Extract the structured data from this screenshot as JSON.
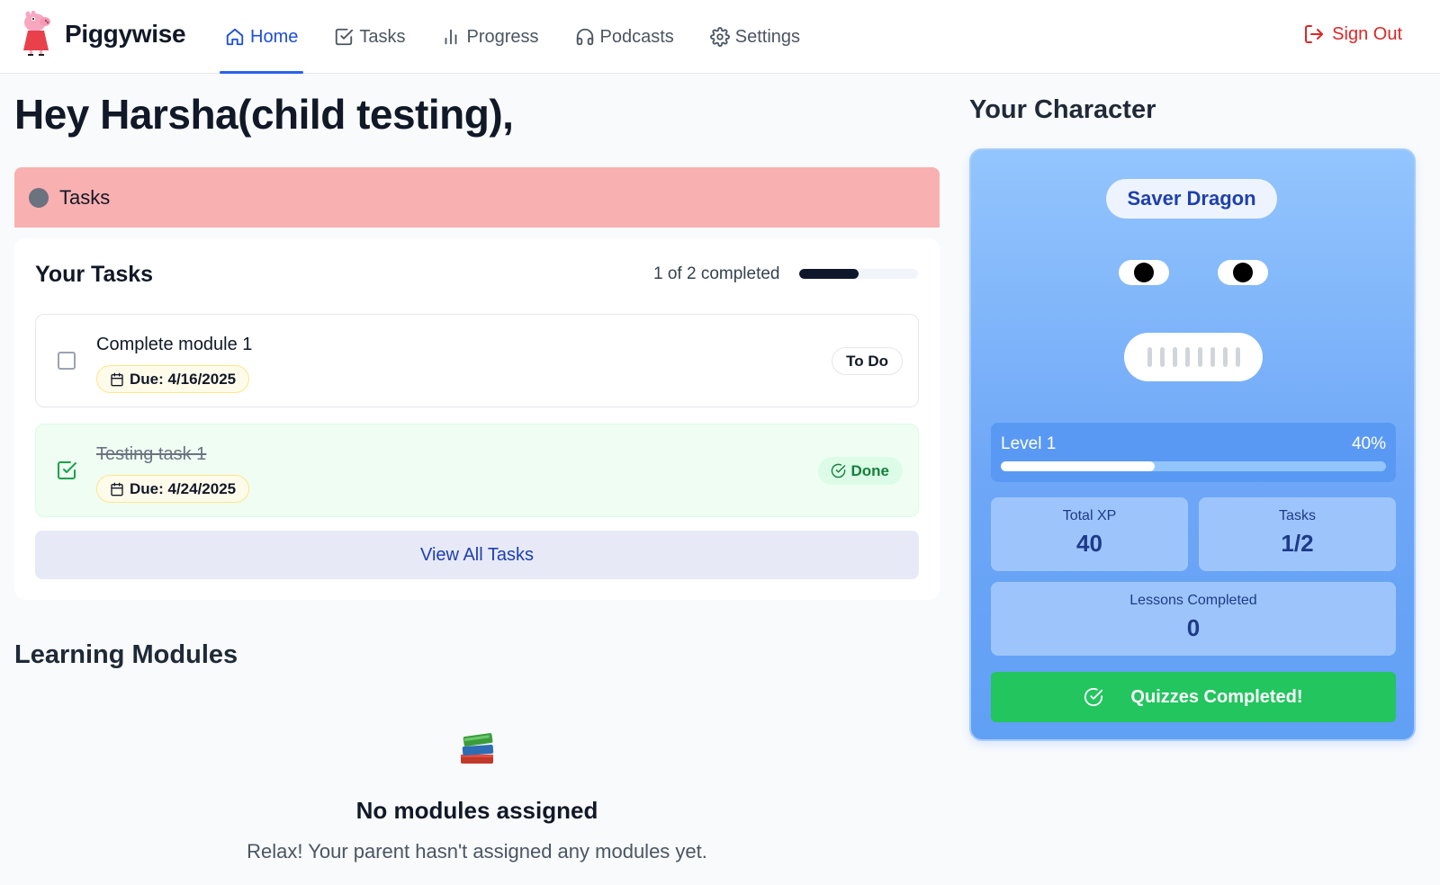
{
  "app": {
    "name": "Piggywise",
    "sign_out_label": "Sign Out"
  },
  "nav": {
    "items": [
      {
        "label": "Home",
        "icon": "home-icon",
        "active": true
      },
      {
        "label": "Tasks",
        "icon": "checkbox-icon",
        "active": false
      },
      {
        "label": "Progress",
        "icon": "bar-chart-icon",
        "active": false
      },
      {
        "label": "Podcasts",
        "icon": "headphones-icon",
        "active": false
      },
      {
        "label": "Settings",
        "icon": "gear-icon",
        "active": false
      }
    ]
  },
  "greeting": "Hey Harsha(child testing),",
  "banner": {
    "label": "Tasks"
  },
  "tasks": {
    "title": "Your Tasks",
    "progress_text": "1 of 2 completed",
    "completed": 1,
    "total": 2,
    "items": [
      {
        "title": "Complete module 1",
        "due": "Due: 4/16/2025",
        "status": "To Do",
        "done": false
      },
      {
        "title": "Testing task 1",
        "due": "Due: 4/24/2025",
        "status": "Done",
        "done": true
      }
    ],
    "view_all_label": "View All Tasks"
  },
  "modules": {
    "title": "Learning Modules",
    "empty_title": "No modules assigned",
    "empty_subtitle": "Relax! Your parent hasn't assigned any modules yet."
  },
  "character": {
    "heading": "Your Character",
    "name": "Saver Dragon",
    "level_label": "Level 1",
    "level_percent_text": "40%",
    "level_progress": 0.4,
    "stats": {
      "xp_label": "Total XP",
      "xp_value": "40",
      "tasks_label": "Tasks",
      "tasks_value": "1/2",
      "lessons_label": "Lessons Completed",
      "lessons_value": "0"
    },
    "quiz_label": "Quizzes Completed!"
  },
  "colors": {
    "accent": "#2563eb",
    "danger": "#dc2626",
    "banner": "#f9b0b0",
    "success": "#22c55e"
  }
}
